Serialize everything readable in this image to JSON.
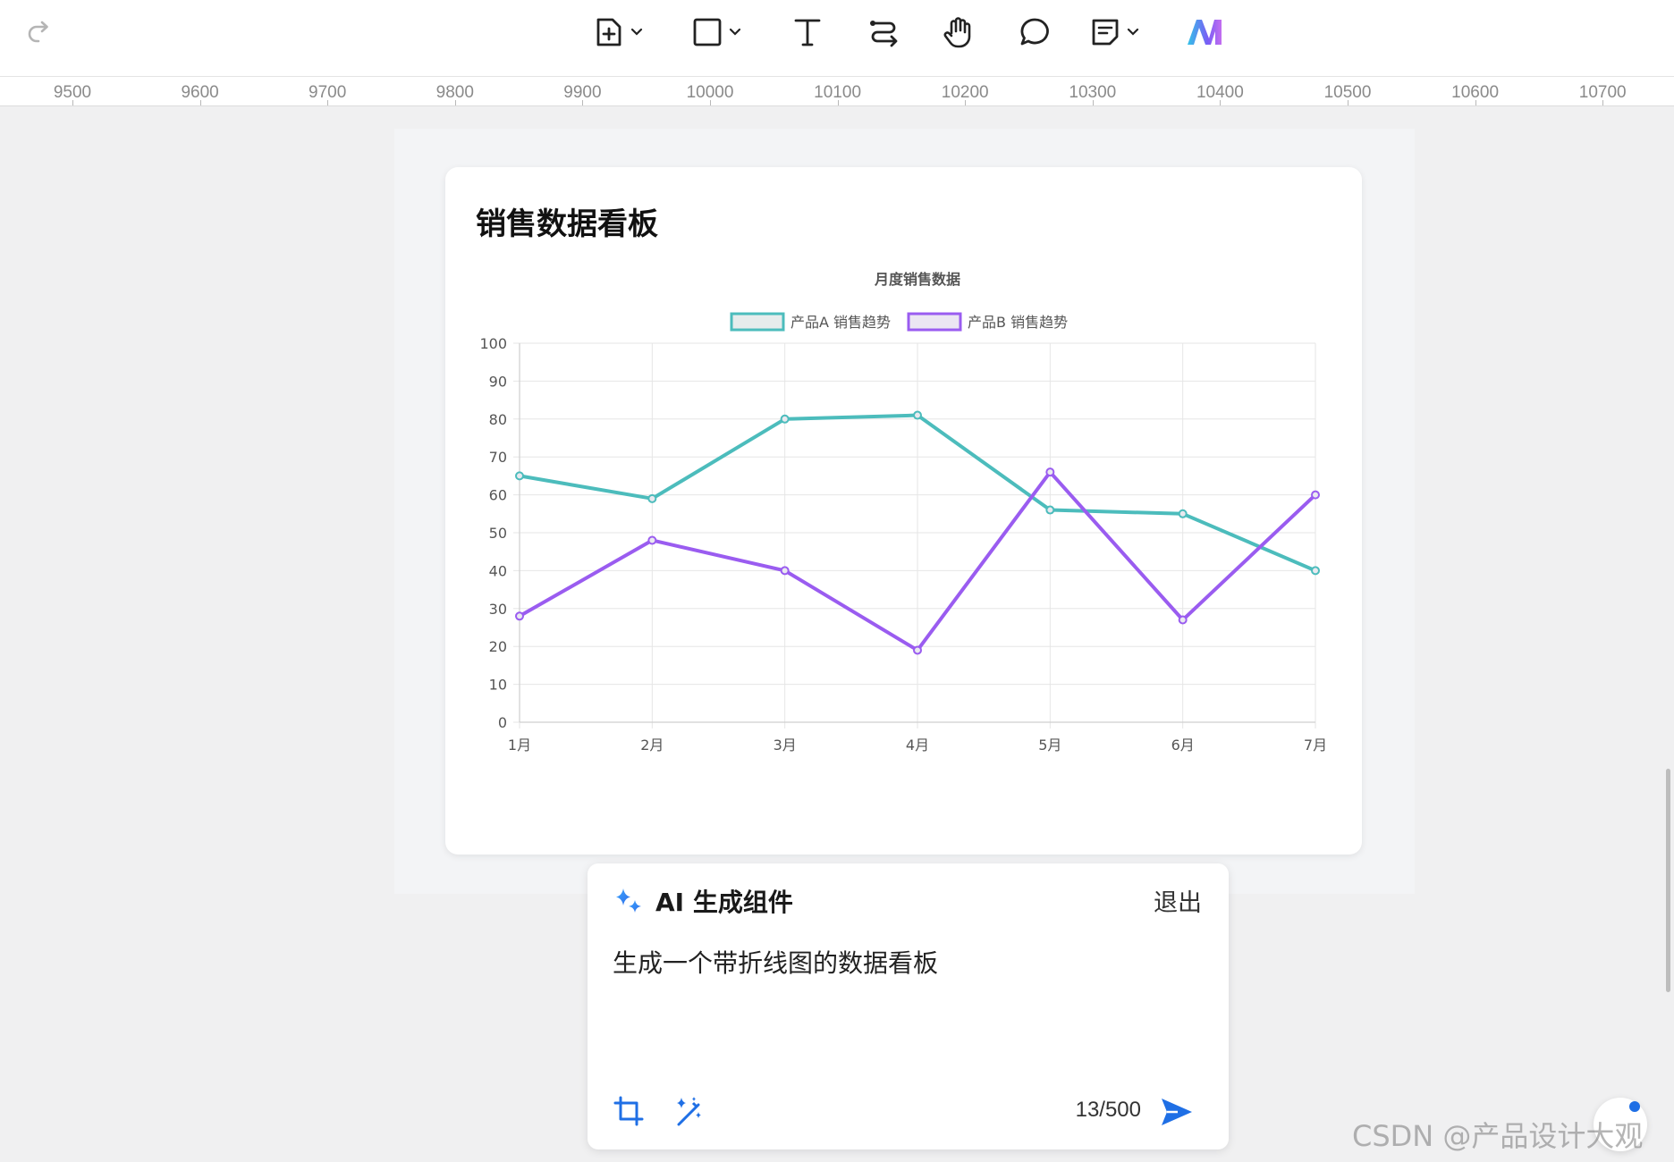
{
  "colors": {
    "series_a": "#4cbcbc",
    "series_b": "#9a5cf0",
    "accent": "#1f6fe5",
    "grid": "#e6e6e6"
  },
  "toolbar": {
    "redo_icon": "redo-icon",
    "tools": [
      {
        "name": "add-page-tool",
        "icon": "square-plus-icon",
        "has_dropdown": true
      },
      {
        "name": "shape-tool",
        "icon": "rectangle-icon",
        "has_dropdown": true
      },
      {
        "name": "text-tool",
        "icon": "text-t-icon",
        "has_dropdown": false
      },
      {
        "name": "connector-tool",
        "icon": "connector-icon",
        "has_dropdown": false
      },
      {
        "name": "hand-tool",
        "icon": "hand-icon",
        "has_dropdown": false
      },
      {
        "name": "comment-tool",
        "icon": "speech-bubble-icon",
        "has_dropdown": false
      },
      {
        "name": "note-tool",
        "icon": "note-icon",
        "has_dropdown": true
      },
      {
        "name": "ai-logo",
        "icon": "ai-logo-icon",
        "has_dropdown": false
      }
    ]
  },
  "ruler": {
    "labels": [
      "9500",
      "9600",
      "9700",
      "9800",
      "9900",
      "10000",
      "10100",
      "10200",
      "10300",
      "10400",
      "10500",
      "10600",
      "10700"
    ]
  },
  "card": {
    "title": "销售数据看板"
  },
  "chart_data": {
    "type": "line",
    "title": "月度销售数据",
    "categories": [
      "1月",
      "2月",
      "3月",
      "4月",
      "5月",
      "6月",
      "7月"
    ],
    "series": [
      {
        "name": "产品A 销售趋势",
        "values": [
          65,
          59,
          80,
          81,
          56,
          55,
          40
        ]
      },
      {
        "name": "产品B 销售趋势",
        "values": [
          28,
          48,
          40,
          19,
          66,
          27,
          60
        ]
      }
    ],
    "ylim": [
      0,
      100
    ],
    "yticks": [
      "0",
      "10",
      "20",
      "30",
      "40",
      "50",
      "60",
      "70",
      "80",
      "90",
      "100"
    ],
    "grid": true,
    "legend": "top-center"
  },
  "ai_panel": {
    "title": "AI 生成组件",
    "exit_label": "退出",
    "prompt": "生成一个带折线图的数据看板",
    "counter": "13/500",
    "icons": [
      "crop-icon",
      "magic-wand-icon",
      "send-icon",
      "sparkle-icon"
    ]
  },
  "watermark": "CSDN @产品设计大观"
}
